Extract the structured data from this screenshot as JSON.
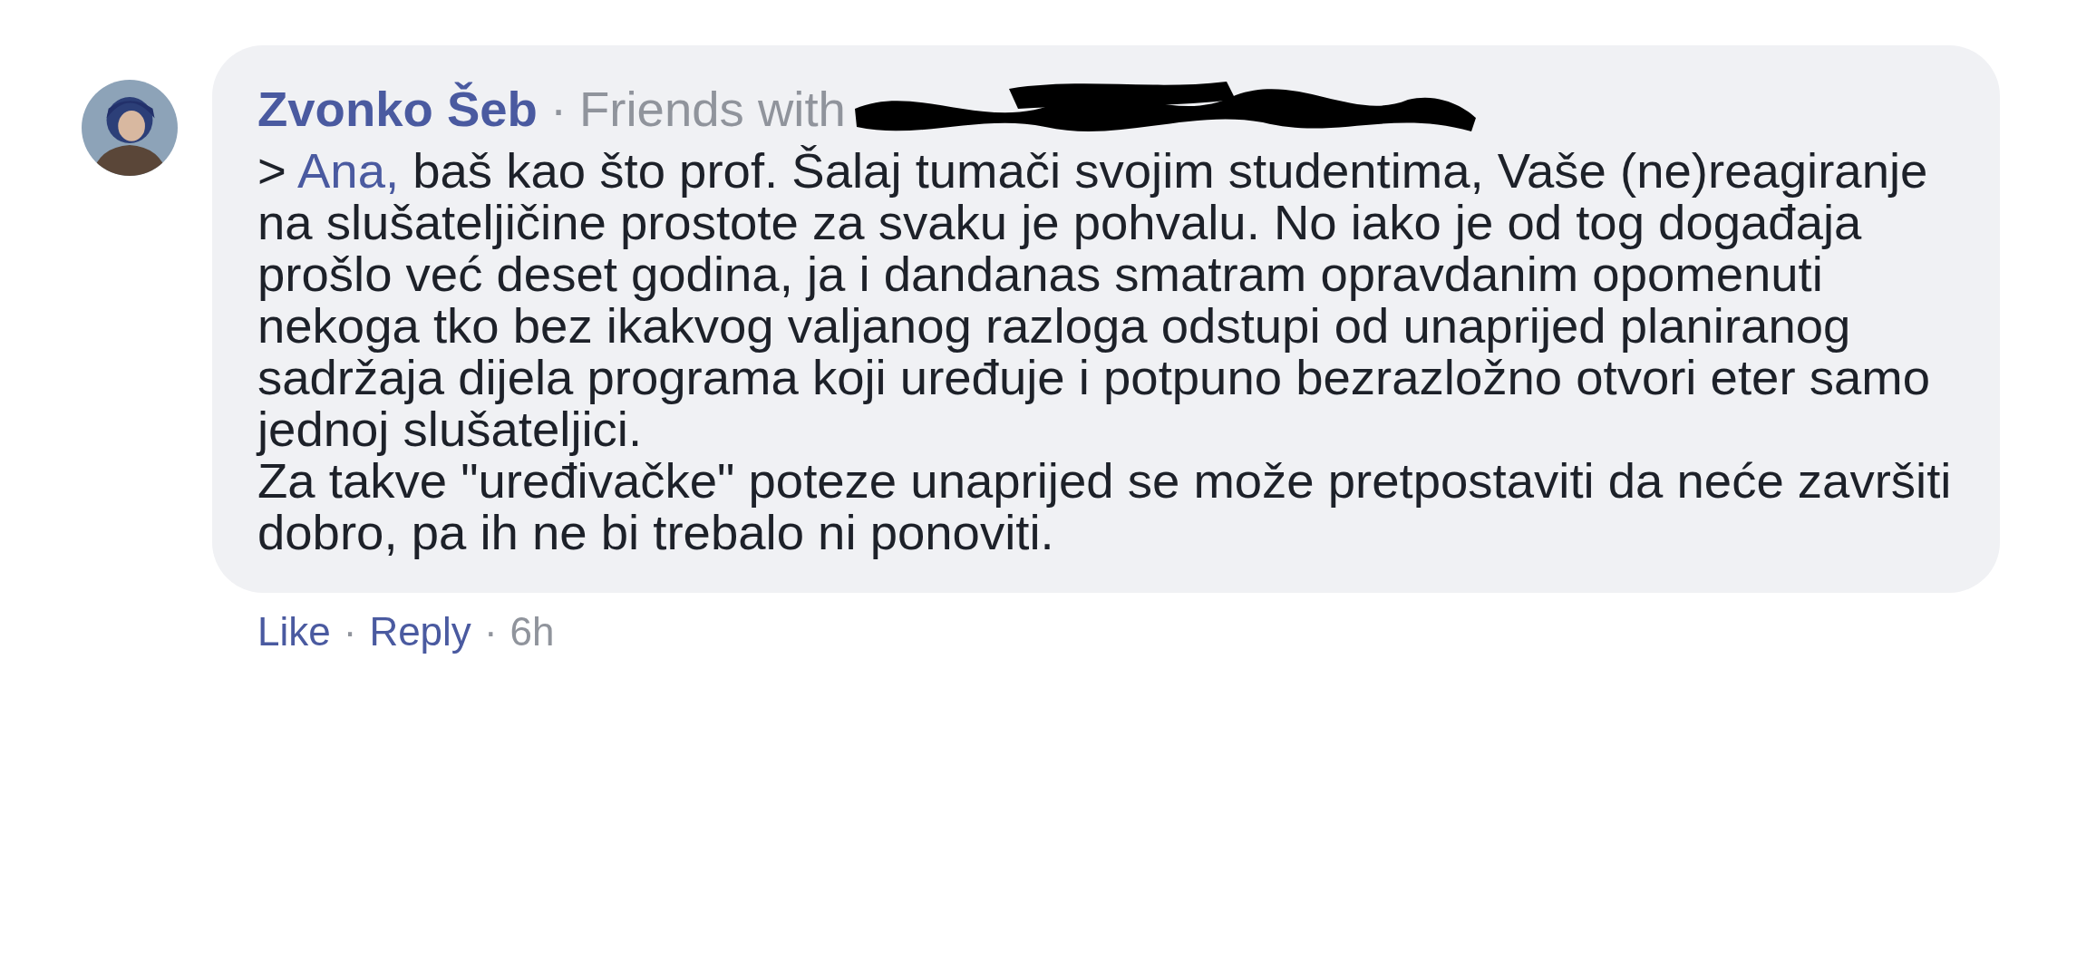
{
  "comment": {
    "author": "Zvonko Šeb",
    "separator": "·",
    "friends_label": "Friends with",
    "redacted": true,
    "prefix": ">",
    "mention": "Ana,",
    "paragraphs": [
      "baš kao što prof. Šalaj tumači svojim studentima, Vaše (ne)reagiranje na slušateljičine prostote za svaku je pohvalu. No iako je od tog događaja prošlo već deset godina, ja i dandanas smatram opravdanim opomenuti nekoga tko bez ikakvog valjanog razloga odstupi od unaprijed planiranog sadržaja dijela programa koji uređuje i potpuno bezrazložno otvori eter samo jednoj slušateljici.",
      "Za takve \"uređivačke\" poteze unaprijed se može pretpostaviti da neće završiti dobro, pa ih ne bi trebalo ni ponoviti."
    ],
    "actions": [
      {
        "kind": "link",
        "label": "Like"
      },
      {
        "kind": "link",
        "label": "Reply"
      },
      {
        "kind": "time",
        "label": "6h"
      }
    ]
  }
}
